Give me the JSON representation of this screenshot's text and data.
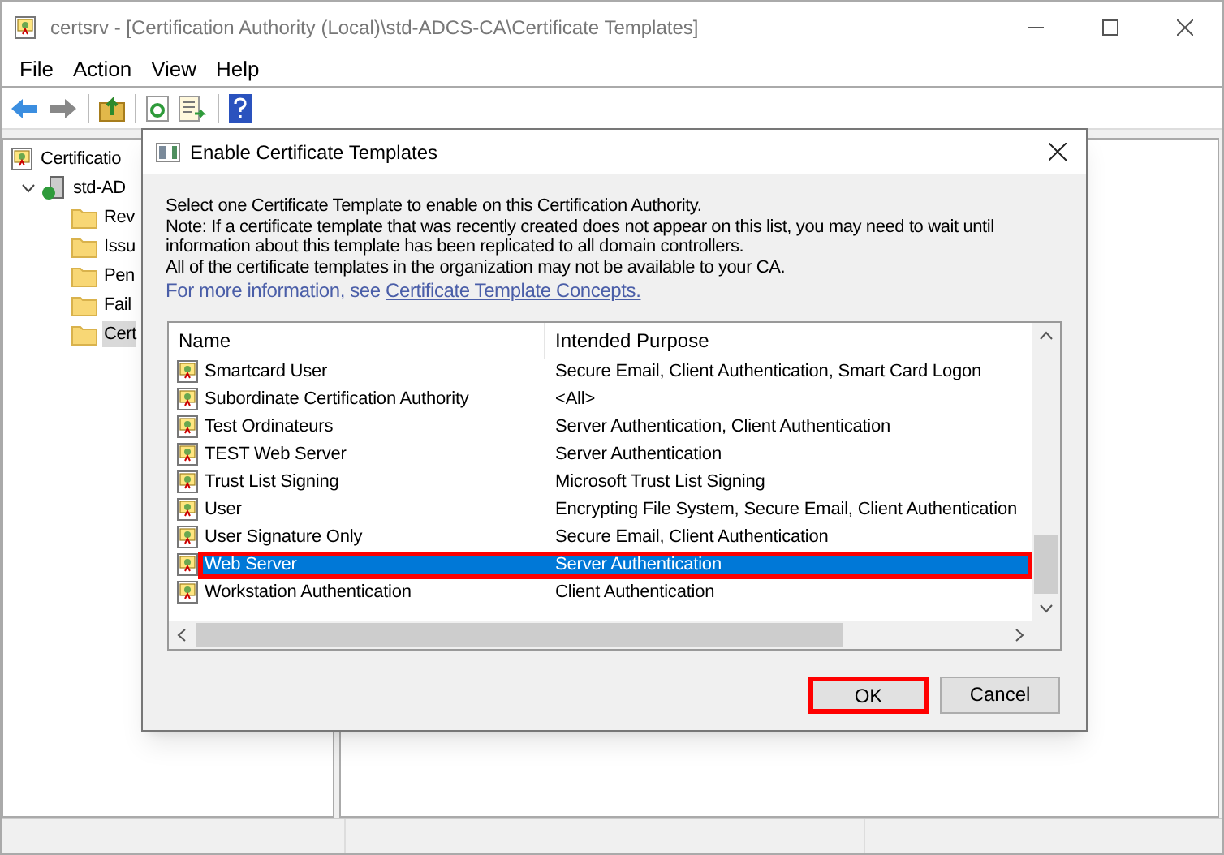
{
  "window": {
    "title": "certsrv - [Certification Authority (Local)\\std-ADCS-CA\\Certificate Templates]"
  },
  "menu": [
    "File",
    "Action",
    "View",
    "Help"
  ],
  "tree": {
    "label": "Certificatio",
    "children": [
      {
        "label": "std-AD",
        "expanded": true,
        "children": [
          {
            "label": "Rev",
            "selected": false
          },
          {
            "label": "Issu",
            "selected": false
          },
          {
            "label": "Pen",
            "selected": false
          },
          {
            "label": "Fail",
            "selected": false
          },
          {
            "label": "Cert",
            "selected": true
          }
        ]
      }
    ]
  },
  "dialog": {
    "title": "Enable Certificate Templates",
    "intro": [
      "Select one Certificate Template to enable on this Certification Authority.",
      "Note: If a certificate template that was recently created does not appear on this list, you may need to wait until information about this template has been replicated to all domain controllers.",
      "All of the certificate templates in the organization may not be available to your CA."
    ],
    "more_info": {
      "text": "For more information, see",
      "link": "Certificate Template Concepts."
    },
    "columns": [
      "Name",
      "Intended Purpose"
    ],
    "rows": [
      {
        "name": "Smartcard User",
        "purpose": "Secure Email, Client Authentication, Smart Card Logon",
        "selected": false,
        "highlighted": false
      },
      {
        "name": "Subordinate Certification Authority",
        "purpose": "<All>",
        "selected": false,
        "highlighted": false
      },
      {
        "name": "Test Ordinateurs",
        "purpose": "Server Authentication, Client Authentication",
        "selected": false,
        "highlighted": false
      },
      {
        "name": "TEST Web Server",
        "purpose": "Server Authentication",
        "selected": false,
        "highlighted": false
      },
      {
        "name": "Trust List Signing",
        "purpose": "Microsoft Trust List Signing",
        "selected": false,
        "highlighted": false
      },
      {
        "name": "User",
        "purpose": "Encrypting File System, Secure Email, Client Authentication",
        "selected": false,
        "highlighted": false
      },
      {
        "name": "User Signature Only",
        "purpose": "Secure Email, Client Authentication",
        "selected": false,
        "highlighted": false
      },
      {
        "name": "Web Server",
        "purpose": "Server Authentication",
        "selected": true,
        "highlighted": true
      },
      {
        "name": "Workstation Authentication",
        "purpose": "Client Authentication",
        "selected": false,
        "highlighted": false
      }
    ],
    "buttons": [
      {
        "label": "OK",
        "highlighted": true
      },
      {
        "label": "Cancel",
        "highlighted": false
      }
    ]
  }
}
